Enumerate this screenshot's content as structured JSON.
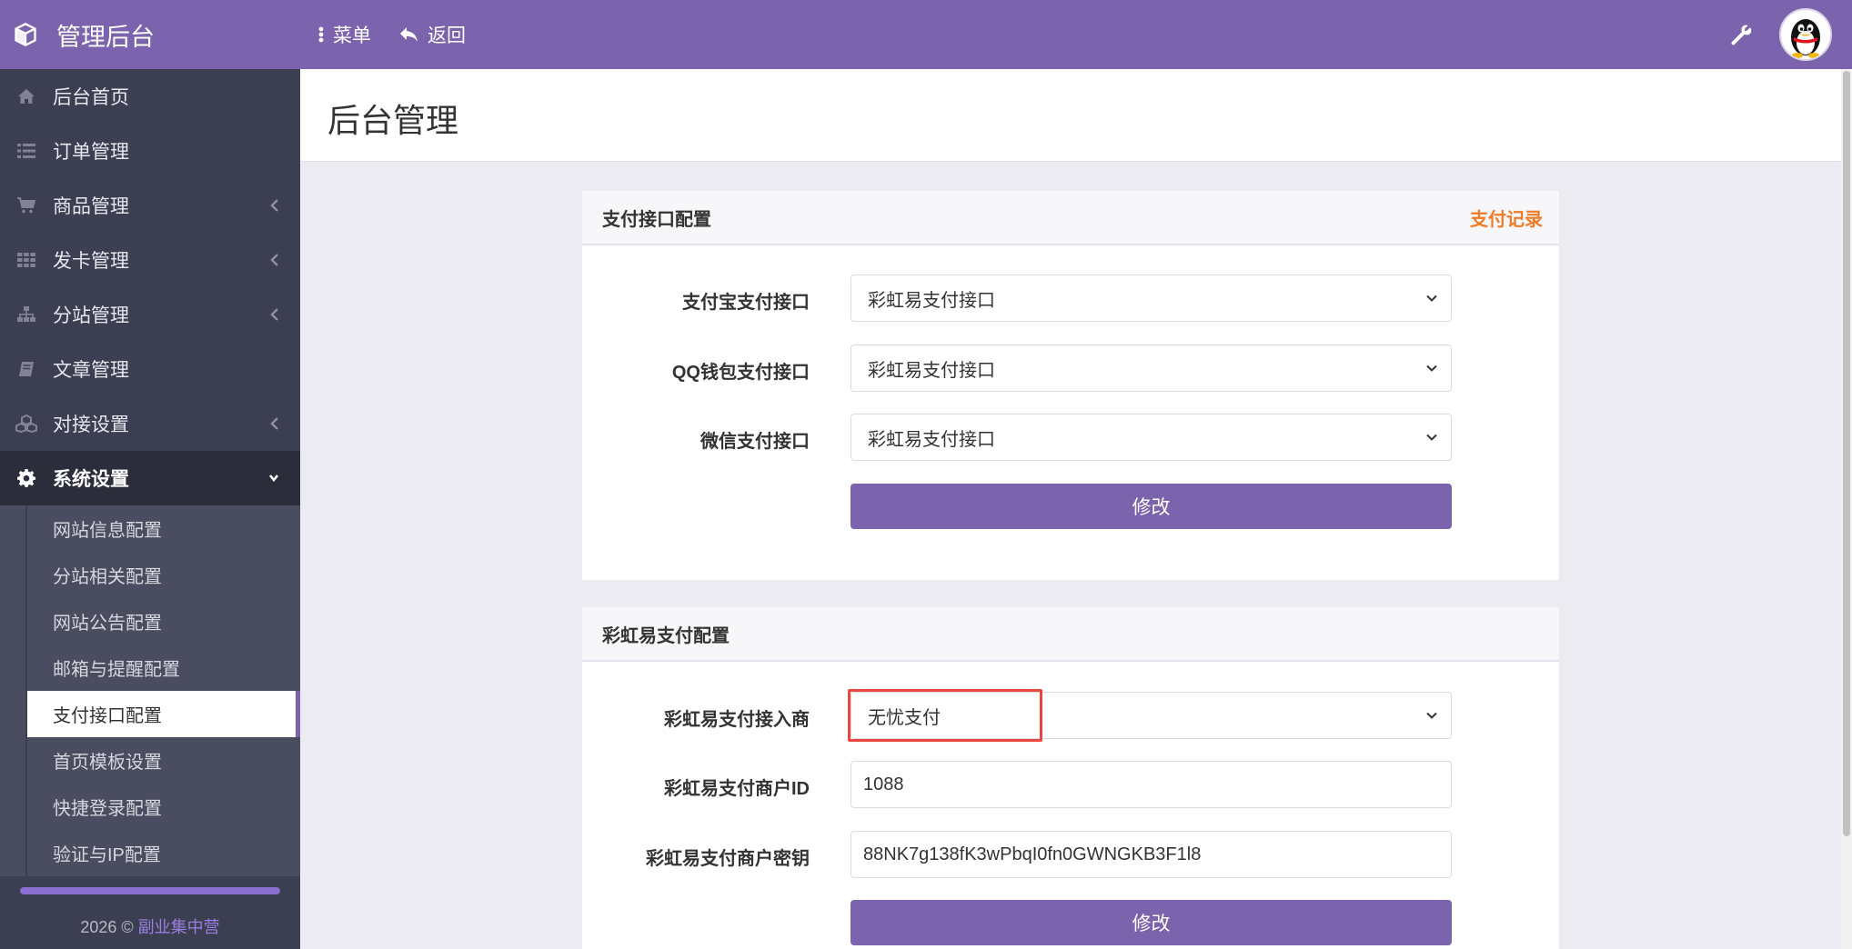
{
  "header": {
    "brand_title": "管理后台",
    "menu_label": "菜单",
    "back_label": "返回"
  },
  "sidebar": {
    "items": [
      {
        "label": "后台首页",
        "icon": "home-icon"
      },
      {
        "label": "订单管理",
        "icon": "list-icon"
      },
      {
        "label": "商品管理",
        "icon": "cart-icon"
      },
      {
        "label": "发卡管理",
        "icon": "grid-icon"
      },
      {
        "label": "分站管理",
        "icon": "sitemap-icon"
      },
      {
        "label": "文章管理",
        "icon": "book-icon"
      },
      {
        "label": "对接设置",
        "icon": "cubes-icon"
      },
      {
        "label": "系统设置",
        "icon": "gear-icon"
      }
    ],
    "subitems": [
      {
        "label": "网站信息配置"
      },
      {
        "label": "分站相关配置"
      },
      {
        "label": "网站公告配置"
      },
      {
        "label": "邮箱与提醒配置"
      },
      {
        "label": "支付接口配置"
      },
      {
        "label": "首页模板设置"
      },
      {
        "label": "快捷登录配置"
      },
      {
        "label": "验证与IP配置"
      }
    ],
    "footer": {
      "year": "2026 ©",
      "link": "副业集中营"
    }
  },
  "main": {
    "page_title": "后台管理",
    "panel1": {
      "title": "支付接口配置",
      "link": "支付记录",
      "fields": [
        {
          "label": "支付宝支付接口",
          "value": "彩虹易支付接口"
        },
        {
          "label": "QQ钱包支付接口",
          "value": "彩虹易支付接口"
        },
        {
          "label": "微信支付接口",
          "value": "彩虹易支付接口"
        }
      ],
      "submit_label": "修改"
    },
    "panel2": {
      "title": "彩虹易支付配置",
      "fields": [
        {
          "label": "彩虹易支付接入商",
          "value": "无忧支付"
        },
        {
          "label": "彩虹易支付商户ID",
          "value": "1088"
        },
        {
          "label": "彩虹易支付商户密钥",
          "value": "88NK7g138fK3wPbqI0fn0GWNGKB3F1l8"
        }
      ],
      "submit_label": "修改"
    }
  },
  "colors": {
    "accent": "#7b63ad",
    "sidebar": "#3c3f52",
    "link_orange": "#f07b27",
    "highlight_red": "#e8473f"
  }
}
